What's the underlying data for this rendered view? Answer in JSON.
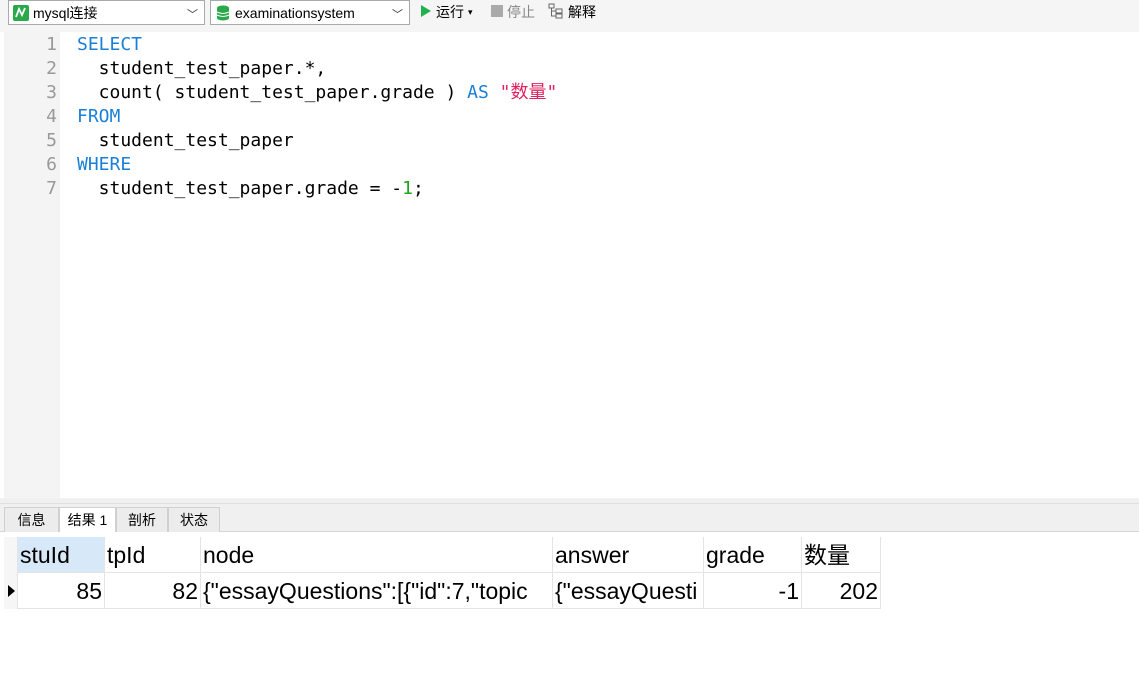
{
  "toolbar": {
    "connection": {
      "value": "mysql连接",
      "icon": "mysql-connection-icon"
    },
    "database": {
      "value": "examinationsystem",
      "icon": "database-icon"
    },
    "run_label": "运行",
    "stop_label": "停止",
    "explain_label": "解释"
  },
  "editor": {
    "line_numbers": [
      "1",
      "2",
      "3",
      "4",
      "5",
      "6",
      "7"
    ],
    "lines": {
      "l1_kw": "SELECT",
      "l2": "  student_test_paper.*,",
      "l3_a": "  count( student_test_paper.grade ) ",
      "l3_kw": "AS",
      "l3_sp": " ",
      "l3_str": "\"数量\"",
      "l4_kw": "FROM",
      "l5": "  student_test_paper",
      "l6_kw": "WHERE",
      "l7_a": "  student_test_paper.grade = -",
      "l7_num": "1",
      "l7_b": ";"
    }
  },
  "tabs": [
    {
      "label": "信息"
    },
    {
      "label": "结果 1"
    },
    {
      "label": "剖析"
    },
    {
      "label": "状态"
    }
  ],
  "result": {
    "columns": [
      "stuId",
      "tpId",
      "node",
      "answer",
      "grade",
      "数量"
    ],
    "rows": [
      [
        "85",
        "82",
        "{\"essayQuestions\":[{\"id\":7,\"topic",
        "{\"essayQuesti",
        "-1",
        "202"
      ]
    ]
  },
  "colors": {
    "keyword": "#1a7fd8",
    "string": "#e0245e",
    "number": "#1fa31f",
    "run_green": "#22b14c"
  }
}
